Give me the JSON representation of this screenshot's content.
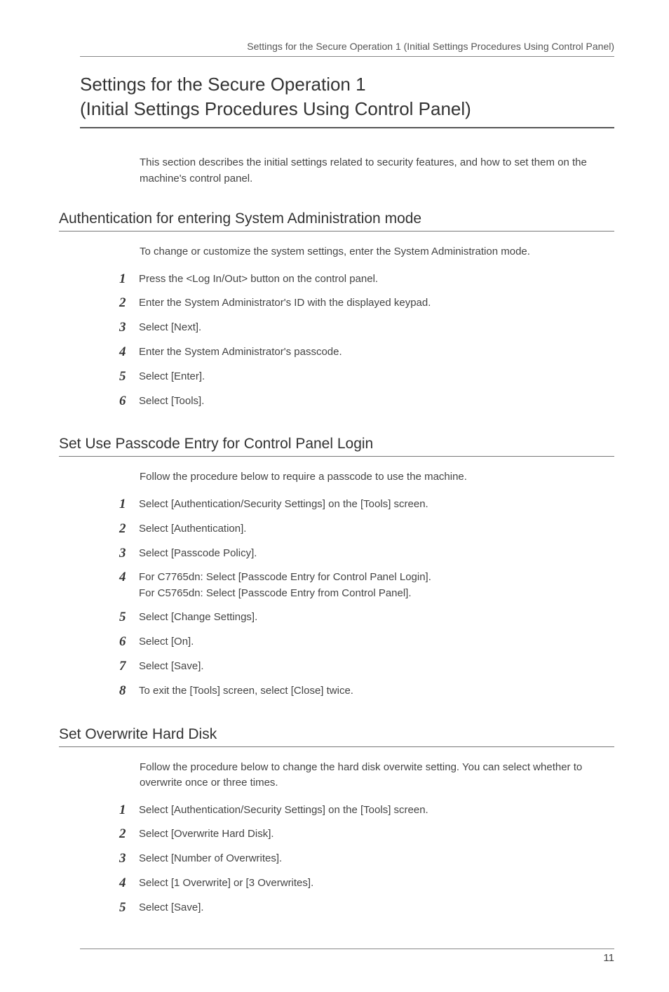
{
  "running_header": "Settings for the Secure Operation 1 (Initial Settings Procedures Using Control Panel)",
  "title_line1": "Settings for the Secure Operation 1",
  "title_line2": "(Initial Settings Procedures Using Control Panel)",
  "intro": "This section describes the initial settings related to security features, and how to set them on the machine's control panel.",
  "sections": [
    {
      "heading": "Authentication for entering System Administration mode",
      "lead": "To change or customize the system settings, enter the System Administration mode.",
      "steps": [
        "Press the <Log In/Out> button on the control panel.",
        "Enter the System Administrator's ID with the displayed keypad.",
        "Select [Next].",
        "Enter the System Administrator's passcode.",
        "Select [Enter].",
        "Select [Tools]."
      ]
    },
    {
      "heading": "Set Use Passcode Entry for Control Panel Login",
      "lead": "Follow the procedure below to require a passcode to use the machine.",
      "steps": [
        "Select [Authentication/Security Settings] on the [Tools] screen.",
        "Select [Authentication].",
        "Select [Passcode Policy].",
        "For C7765dn: Select [Passcode Entry for Control Panel Login].\nFor C5765dn: Select [Passcode Entry from Control Panel].",
        "Select [Change Settings].",
        "Select [On].",
        "Select [Save].",
        "To exit the [Tools] screen, select [Close] twice."
      ]
    },
    {
      "heading": "Set Overwrite Hard Disk",
      "lead": "Follow the procedure below to change the hard disk overwite setting. You can select whether to overwrite once or three times.",
      "steps": [
        "Select [Authentication/Security Settings] on the [Tools] screen.",
        "Select [Overwrite Hard Disk].",
        "Select [Number of Overwrites].",
        "Select [1 Overwrite] or [3 Overwrites].",
        "Select [Save]."
      ]
    }
  ],
  "page_number": "11"
}
